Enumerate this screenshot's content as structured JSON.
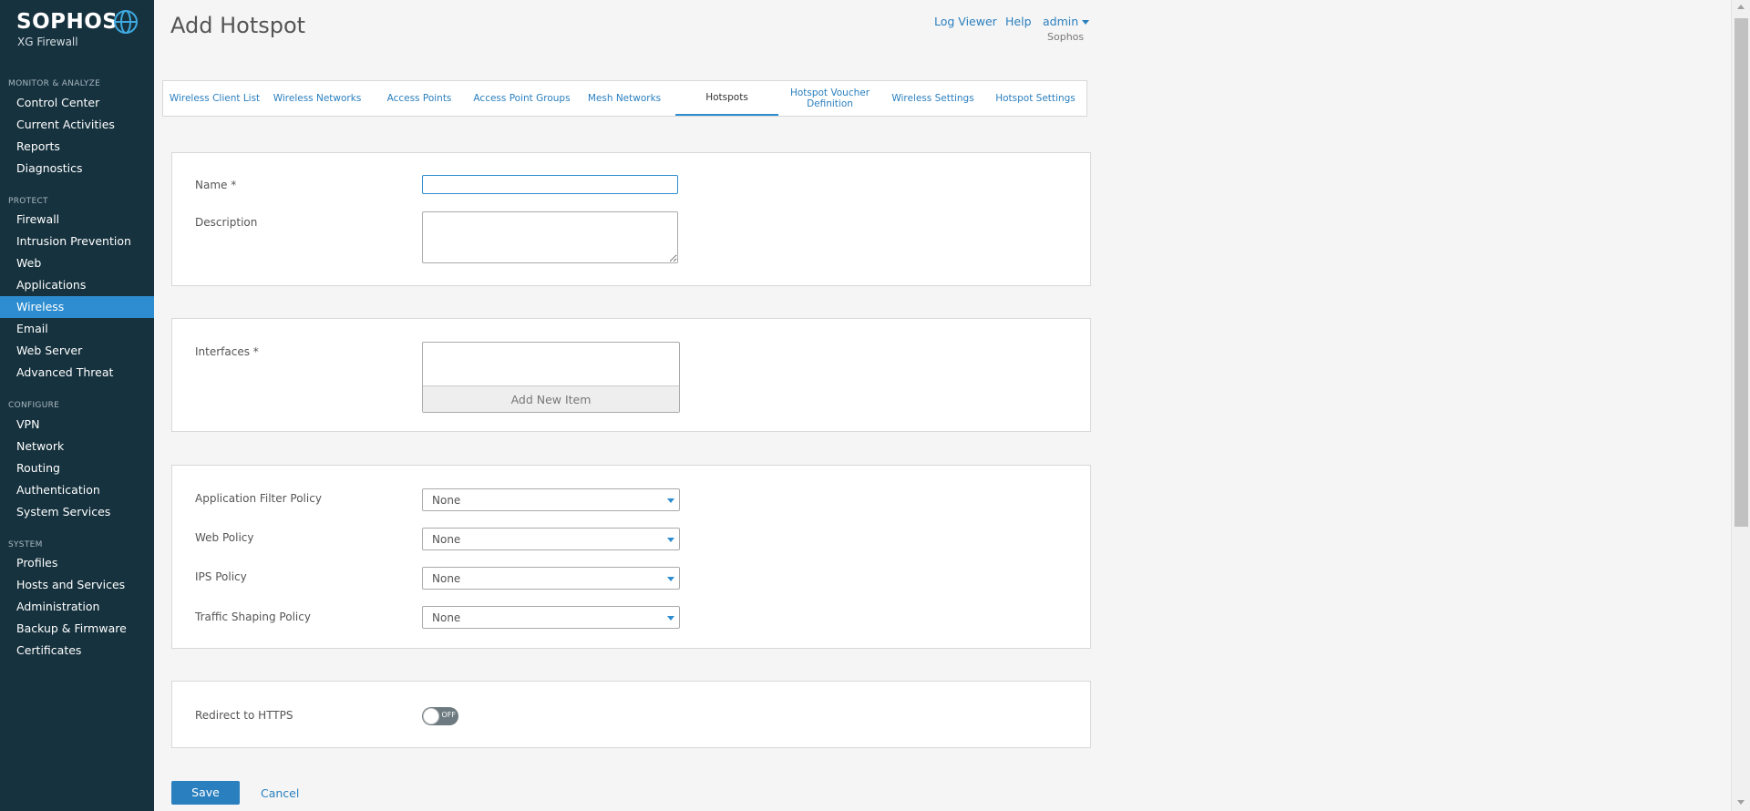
{
  "brand": {
    "name": "SOPHOS",
    "product": "XG Firewall"
  },
  "sidebar": {
    "sections": [
      {
        "label": "MONITOR & ANALYZE",
        "items": [
          "Control Center",
          "Current Activities",
          "Reports",
          "Diagnostics"
        ]
      },
      {
        "label": "PROTECT",
        "items": [
          "Firewall",
          "Intrusion Prevention",
          "Web",
          "Applications",
          "Wireless",
          "Email",
          "Web Server",
          "Advanced Threat"
        ]
      },
      {
        "label": "CONFIGURE",
        "items": [
          "VPN",
          "Network",
          "Routing",
          "Authentication",
          "System Services"
        ]
      },
      {
        "label": "SYSTEM",
        "items": [
          "Profiles",
          "Hosts and Services",
          "Administration",
          "Backup & Firmware",
          "Certificates"
        ]
      }
    ],
    "active": "Wireless"
  },
  "header": {
    "title": "Add Hotspot",
    "log_viewer": "Log Viewer",
    "help": "Help",
    "user": "admin",
    "org": "Sophos"
  },
  "tabs": [
    {
      "label": "Wireless Client List"
    },
    {
      "label": "Wireless Networks"
    },
    {
      "label": "Access Points"
    },
    {
      "label": "Access Point Groups"
    },
    {
      "label": "Mesh Networks"
    },
    {
      "label": "Hotspots",
      "active": true
    },
    {
      "label": "Hotspot Voucher Definition"
    },
    {
      "label": "Wireless Settings"
    },
    {
      "label": "Hotspot Settings"
    }
  ],
  "form": {
    "name_label": "Name *",
    "name_value": "",
    "description_label": "Description",
    "description_value": "",
    "interfaces_label": "Interfaces *",
    "add_new_item": "Add New Item",
    "app_filter_label": "Application Filter Policy",
    "app_filter_value": "None",
    "web_policy_label": "Web Policy",
    "web_policy_value": "None",
    "ips_policy_label": "IPS Policy",
    "ips_policy_value": "None",
    "traffic_label": "Traffic Shaping Policy",
    "traffic_value": "None",
    "redirect_label": "Redirect to HTTPS",
    "redirect_state": "OFF"
  },
  "footer": {
    "save": "Save",
    "cancel": "Cancel"
  },
  "colors": {
    "sidebar_bg": "#16323e",
    "accent": "#2d8dd0",
    "link": "#2a7fbf"
  }
}
